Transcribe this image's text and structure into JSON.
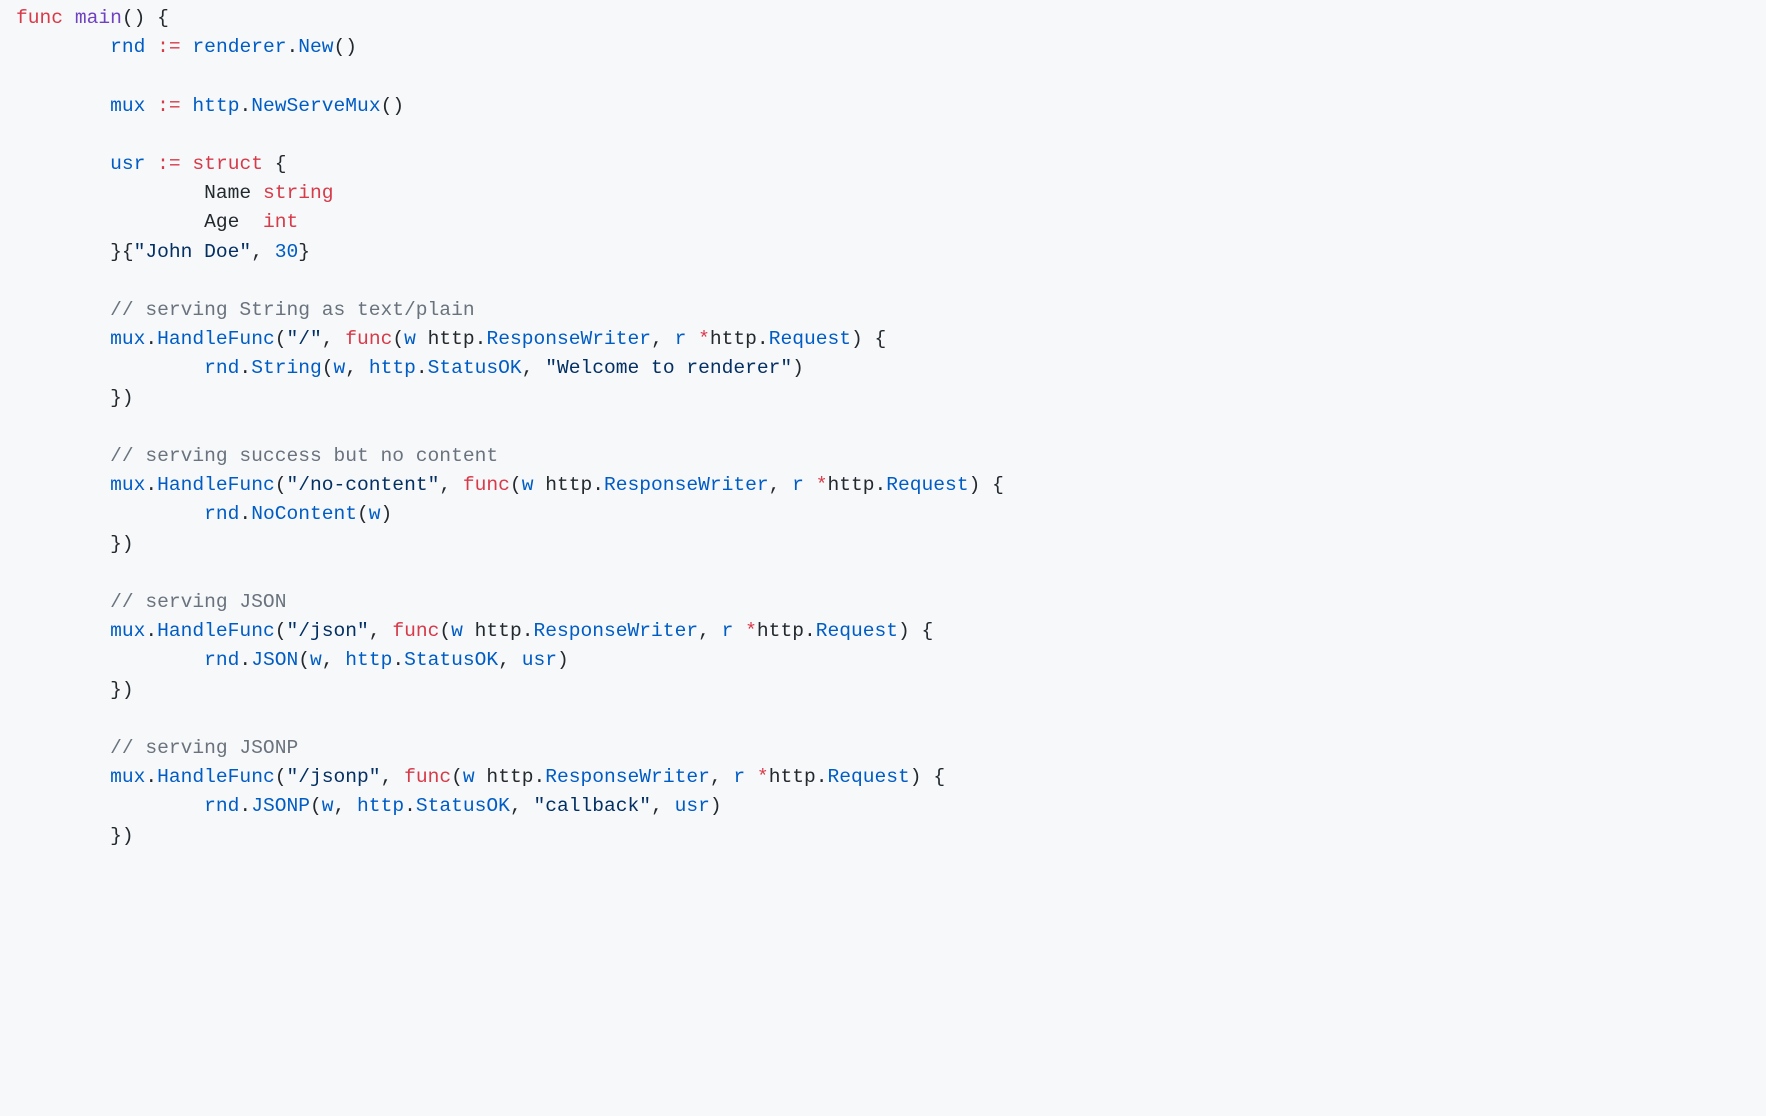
{
  "code": {
    "lines": [
      {
        "indent": 0,
        "tokens": [
          {
            "cls": "k",
            "t": "func"
          },
          {
            "t": " "
          },
          {
            "cls": "fn",
            "t": "main"
          },
          {
            "t": "() {"
          }
        ]
      },
      {
        "indent": 1,
        "tokens": [
          {
            "cls": "nm",
            "t": "rnd"
          },
          {
            "t": " "
          },
          {
            "cls": "k",
            "t": ":="
          },
          {
            "t": " "
          },
          {
            "cls": "nm",
            "t": "renderer"
          },
          {
            "t": "."
          },
          {
            "cls": "nm",
            "t": "New"
          },
          {
            "t": "()"
          }
        ]
      },
      {
        "indent": 0,
        "tokens": []
      },
      {
        "indent": 1,
        "tokens": [
          {
            "cls": "nm",
            "t": "mux"
          },
          {
            "t": " "
          },
          {
            "cls": "k",
            "t": ":="
          },
          {
            "t": " "
          },
          {
            "cls": "nm",
            "t": "http"
          },
          {
            "t": "."
          },
          {
            "cls": "nm",
            "t": "NewServeMux"
          },
          {
            "t": "()"
          }
        ]
      },
      {
        "indent": 0,
        "tokens": []
      },
      {
        "indent": 1,
        "tokens": [
          {
            "cls": "nm",
            "t": "usr"
          },
          {
            "t": " "
          },
          {
            "cls": "k",
            "t": ":="
          },
          {
            "t": " "
          },
          {
            "cls": "k",
            "t": "struct"
          },
          {
            "t": " {"
          }
        ]
      },
      {
        "indent": 2,
        "tokens": [
          {
            "t": "Name "
          },
          {
            "cls": "k",
            "t": "string"
          }
        ]
      },
      {
        "indent": 2,
        "tokens": [
          {
            "t": "Age  "
          },
          {
            "cls": "k",
            "t": "int"
          }
        ]
      },
      {
        "indent": 1,
        "tokens": [
          {
            "t": "}{"
          },
          {
            "cls": "s",
            "t": "\"John Doe\""
          },
          {
            "t": ", "
          },
          {
            "cls": "nm",
            "t": "30"
          },
          {
            "t": "}"
          }
        ]
      },
      {
        "indent": 0,
        "tokens": []
      },
      {
        "indent": 1,
        "tokens": [
          {
            "cls": "c",
            "t": "// serving String as text/plain"
          }
        ]
      },
      {
        "indent": 1,
        "tokens": [
          {
            "cls": "nm",
            "t": "mux"
          },
          {
            "t": "."
          },
          {
            "cls": "nm",
            "t": "HandleFunc"
          },
          {
            "t": "("
          },
          {
            "cls": "s",
            "t": "\"/\""
          },
          {
            "t": ", "
          },
          {
            "cls": "k",
            "t": "func"
          },
          {
            "t": "("
          },
          {
            "cls": "nm",
            "t": "w"
          },
          {
            "t": " http."
          },
          {
            "cls": "nm",
            "t": "ResponseWriter"
          },
          {
            "t": ", "
          },
          {
            "cls": "nm",
            "t": "r"
          },
          {
            "t": " "
          },
          {
            "cls": "k",
            "t": "*"
          },
          {
            "t": "http."
          },
          {
            "cls": "nm",
            "t": "Request"
          },
          {
            "t": ") {"
          }
        ]
      },
      {
        "indent": 2,
        "tokens": [
          {
            "cls": "nm",
            "t": "rnd"
          },
          {
            "t": "."
          },
          {
            "cls": "nm",
            "t": "String"
          },
          {
            "t": "("
          },
          {
            "cls": "nm",
            "t": "w"
          },
          {
            "t": ", "
          },
          {
            "cls": "nm",
            "t": "http"
          },
          {
            "t": "."
          },
          {
            "cls": "nm",
            "t": "StatusOK"
          },
          {
            "t": ", "
          },
          {
            "cls": "s",
            "t": "\"Welcome to renderer\""
          },
          {
            "t": ")"
          }
        ]
      },
      {
        "indent": 1,
        "tokens": [
          {
            "t": "})"
          }
        ]
      },
      {
        "indent": 0,
        "tokens": []
      },
      {
        "indent": 1,
        "tokens": [
          {
            "cls": "c",
            "t": "// serving success but no content"
          }
        ]
      },
      {
        "indent": 1,
        "tokens": [
          {
            "cls": "nm",
            "t": "mux"
          },
          {
            "t": "."
          },
          {
            "cls": "nm",
            "t": "HandleFunc"
          },
          {
            "t": "("
          },
          {
            "cls": "s",
            "t": "\"/no-content\""
          },
          {
            "t": ", "
          },
          {
            "cls": "k",
            "t": "func"
          },
          {
            "t": "("
          },
          {
            "cls": "nm",
            "t": "w"
          },
          {
            "t": " http."
          },
          {
            "cls": "nm",
            "t": "ResponseWriter"
          },
          {
            "t": ", "
          },
          {
            "cls": "nm",
            "t": "r"
          },
          {
            "t": " "
          },
          {
            "cls": "k",
            "t": "*"
          },
          {
            "t": "http."
          },
          {
            "cls": "nm",
            "t": "Request"
          },
          {
            "t": ") {"
          }
        ]
      },
      {
        "indent": 2,
        "tokens": [
          {
            "cls": "nm",
            "t": "rnd"
          },
          {
            "t": "."
          },
          {
            "cls": "nm",
            "t": "NoContent"
          },
          {
            "t": "("
          },
          {
            "cls": "nm",
            "t": "w"
          },
          {
            "t": ")"
          }
        ]
      },
      {
        "indent": 1,
        "tokens": [
          {
            "t": "})"
          }
        ]
      },
      {
        "indent": 0,
        "tokens": []
      },
      {
        "indent": 1,
        "tokens": [
          {
            "cls": "c",
            "t": "// serving JSON"
          }
        ]
      },
      {
        "indent": 1,
        "tokens": [
          {
            "cls": "nm",
            "t": "mux"
          },
          {
            "t": "."
          },
          {
            "cls": "nm",
            "t": "HandleFunc"
          },
          {
            "t": "("
          },
          {
            "cls": "s",
            "t": "\"/json\""
          },
          {
            "t": ", "
          },
          {
            "cls": "k",
            "t": "func"
          },
          {
            "t": "("
          },
          {
            "cls": "nm",
            "t": "w"
          },
          {
            "t": " http."
          },
          {
            "cls": "nm",
            "t": "ResponseWriter"
          },
          {
            "t": ", "
          },
          {
            "cls": "nm",
            "t": "r"
          },
          {
            "t": " "
          },
          {
            "cls": "k",
            "t": "*"
          },
          {
            "t": "http."
          },
          {
            "cls": "nm",
            "t": "Request"
          },
          {
            "t": ") {"
          }
        ]
      },
      {
        "indent": 2,
        "tokens": [
          {
            "cls": "nm",
            "t": "rnd"
          },
          {
            "t": "."
          },
          {
            "cls": "nm",
            "t": "JSON"
          },
          {
            "t": "("
          },
          {
            "cls": "nm",
            "t": "w"
          },
          {
            "t": ", "
          },
          {
            "cls": "nm",
            "t": "http"
          },
          {
            "t": "."
          },
          {
            "cls": "nm",
            "t": "StatusOK"
          },
          {
            "t": ", "
          },
          {
            "cls": "nm",
            "t": "usr"
          },
          {
            "t": ")"
          }
        ]
      },
      {
        "indent": 1,
        "tokens": [
          {
            "t": "})"
          }
        ]
      },
      {
        "indent": 0,
        "tokens": []
      },
      {
        "indent": 1,
        "tokens": [
          {
            "cls": "c",
            "t": "// serving JSONP"
          }
        ]
      },
      {
        "indent": 1,
        "tokens": [
          {
            "cls": "nm",
            "t": "mux"
          },
          {
            "t": "."
          },
          {
            "cls": "nm",
            "t": "HandleFunc"
          },
          {
            "t": "("
          },
          {
            "cls": "s",
            "t": "\"/jsonp\""
          },
          {
            "t": ", "
          },
          {
            "cls": "k",
            "t": "func"
          },
          {
            "t": "("
          },
          {
            "cls": "nm",
            "t": "w"
          },
          {
            "t": " http."
          },
          {
            "cls": "nm",
            "t": "ResponseWriter"
          },
          {
            "t": ", "
          },
          {
            "cls": "nm",
            "t": "r"
          },
          {
            "t": " "
          },
          {
            "cls": "k",
            "t": "*"
          },
          {
            "t": "http."
          },
          {
            "cls": "nm",
            "t": "Request"
          },
          {
            "t": ") {"
          }
        ]
      },
      {
        "indent": 2,
        "tokens": [
          {
            "cls": "nm",
            "t": "rnd"
          },
          {
            "t": "."
          },
          {
            "cls": "nm",
            "t": "JSONP"
          },
          {
            "t": "("
          },
          {
            "cls": "nm",
            "t": "w"
          },
          {
            "t": ", "
          },
          {
            "cls": "nm",
            "t": "http"
          },
          {
            "t": "."
          },
          {
            "cls": "nm",
            "t": "StatusOK"
          },
          {
            "t": ", "
          },
          {
            "cls": "s",
            "t": "\"callback\""
          },
          {
            "t": ", "
          },
          {
            "cls": "nm",
            "t": "usr"
          },
          {
            "t": ")"
          }
        ]
      },
      {
        "indent": 1,
        "tokens": [
          {
            "t": "})"
          }
        ]
      }
    ],
    "indent_unit": "        "
  }
}
